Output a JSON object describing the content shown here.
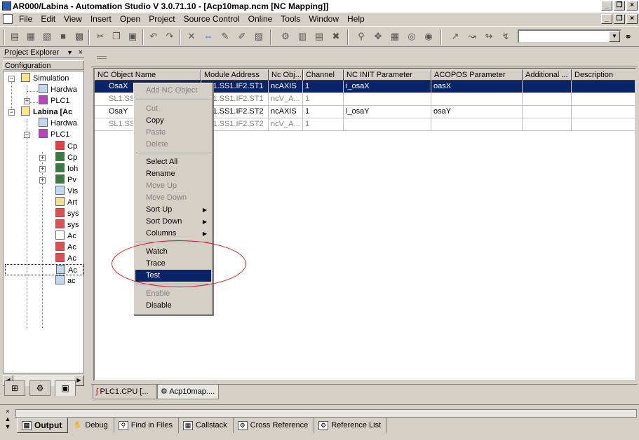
{
  "title": "AR000/Labina - Automation Studio V 3.0.71.10 - [Acp10map.ncm [NC Mapping]]",
  "window_buttons": [
    "_",
    "❐",
    "×"
  ],
  "menu": [
    "File",
    "Edit",
    "View",
    "Insert",
    "Open",
    "Project",
    "Source Control",
    "Online",
    "Tools",
    "Window",
    "Help"
  ],
  "explorer": {
    "title": "Project Explorer",
    "tab_header": "Configuration",
    "nodes": [
      "Simulation",
      "Hardwa",
      "PLC1",
      "Labina [Ac",
      "Hardwa",
      "PLC1",
      "Cp",
      "Cp",
      "Ioh",
      "Pv",
      "Vis",
      "Art",
      "sys",
      "sys",
      "Ac",
      "Ac",
      "Ac",
      "Ac",
      "ac"
    ]
  },
  "grid": {
    "columns": [
      "NC Object Name",
      "Module Address",
      "Nc Obj...",
      "Channel",
      "NC INIT Parameter",
      "ACOPOS Parameter",
      "Additional ...",
      "Description"
    ],
    "rows": [
      [
        "OsaX",
        "SL1.SS1.IF2.ST1",
        "ncAXIS",
        "1",
        "i_osaX",
        "oasX",
        "",
        ""
      ],
      [
        "SL1.SS1.IF2.ST1",
        "SL1.SS1.IF2.ST1",
        "ncV_A...",
        "1",
        "",
        "",
        "",
        ""
      ],
      [
        "OsaY",
        "SL1.SS1.IF2.ST2",
        "ncAXIS",
        "1",
        "i_osaY",
        "osaY",
        "",
        ""
      ],
      [
        "SL1.SS1.IF2.ST2",
        "SL1.SS1.IF2.ST2",
        "ncV_A...",
        "1",
        "",
        "",
        "",
        ""
      ]
    ]
  },
  "context_menu": [
    {
      "label": "Add NC Object",
      "enabled": false
    },
    {
      "label": "Cut",
      "enabled": false
    },
    {
      "label": "Copy",
      "enabled": true
    },
    {
      "label": "Paste",
      "enabled": false
    },
    {
      "label": "Delete",
      "enabled": false
    },
    {
      "label": "Select All",
      "enabled": true
    },
    {
      "label": "Rename",
      "enabled": true
    },
    {
      "label": "Move Up",
      "enabled": false
    },
    {
      "label": "Move Down",
      "enabled": false
    },
    {
      "label": "Sort Up",
      "enabled": true,
      "submenu": true
    },
    {
      "label": "Sort Down",
      "enabled": true,
      "submenu": true
    },
    {
      "label": "Columns",
      "enabled": true,
      "submenu": true
    },
    {
      "label": "Watch",
      "enabled": true
    },
    {
      "label": "Trace",
      "enabled": true
    },
    {
      "label": "Test",
      "enabled": true,
      "highlighted": true
    },
    {
      "label": "Enable",
      "enabled": false
    },
    {
      "label": "Disable",
      "enabled": true
    }
  ],
  "editor_tabs": [
    "PLC1.CPU [...",
    "Acp10map...."
  ],
  "output_tabs": [
    "Output",
    "Debug",
    "Find in Files",
    "Callstack",
    "Cross Reference",
    "Reference List"
  ],
  "colors": {
    "selection": "#0a246a",
    "annotation": "#e02020",
    "face": "#d4d0c8"
  }
}
